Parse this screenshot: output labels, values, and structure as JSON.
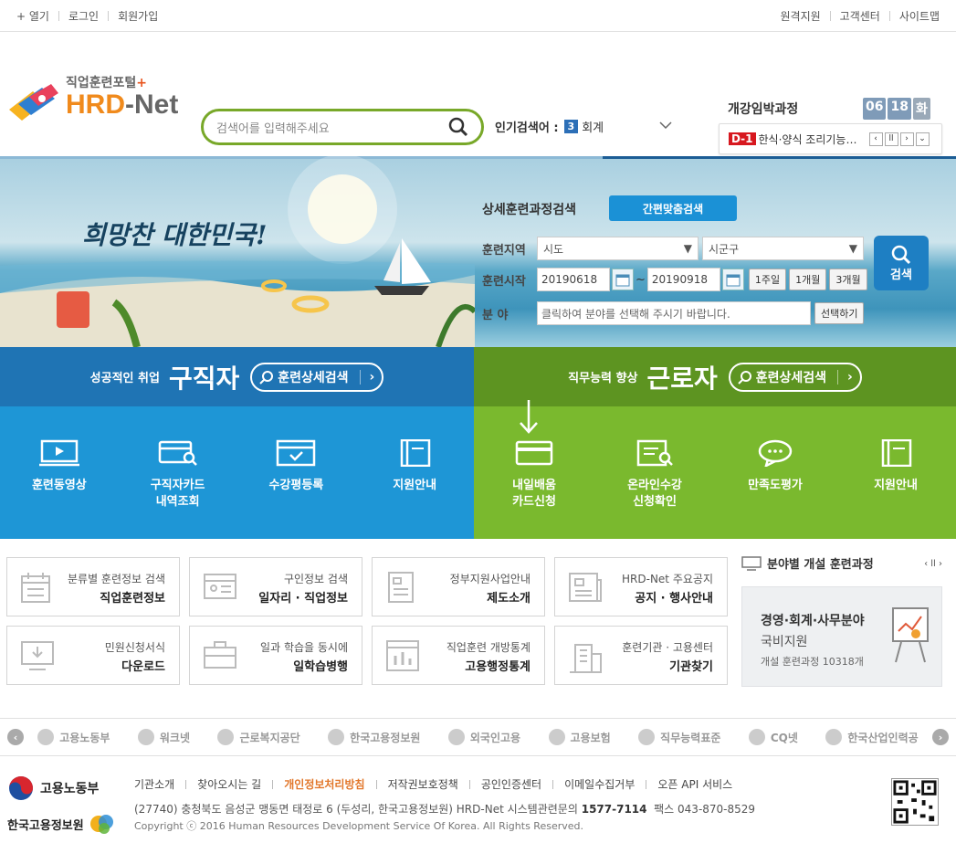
{
  "topbar": {
    "left": [
      "+ 열기",
      "로그인",
      "회원가입"
    ],
    "right": [
      "원격지원",
      "고객센터",
      "사이트맵"
    ]
  },
  "logo": {
    "sub": "직업훈련포털",
    "plus": "+",
    "main_a": "HRD",
    "main_b": "-Net"
  },
  "search": {
    "placeholder": "검색어를 입력해주세요"
  },
  "popular": {
    "label": "인기검색어 :",
    "rank": "3",
    "keyword": "회계"
  },
  "imminent": {
    "title": "개강임박과정",
    "month": "06",
    "day": "18",
    "weekday": "화",
    "badge": "D-1",
    "course": "한식·양식 조리기능사 과정"
  },
  "hero": {
    "slogan": "희망찬 대한민국!",
    "panel_title": "상세훈련과정검색",
    "quick_button": "간편맞춤검색",
    "region_label": "훈련지역",
    "region_select1": "시도",
    "region_select2": "시군구",
    "start_label": "훈련시작",
    "date_from": "20190618",
    "tilde": "~",
    "date_to": "20190918",
    "period_buttons": [
      "1주일",
      "1개월",
      "3개월"
    ],
    "field_label": "분  야",
    "field_placeholder": "클릭하여 분야를 선택해 주시기 바랍니다.",
    "field_button": "선택하기",
    "search_button": "검색"
  },
  "jobseeker": {
    "small": "성공적인 취업",
    "big": "구직자",
    "button": "훈련상세검색",
    "tiles": [
      {
        "l1": "훈련동영상",
        "l2": ""
      },
      {
        "l1": "구직자카드",
        "l2": "내역조회"
      },
      {
        "l1": "수강평등록",
        "l2": ""
      },
      {
        "l1": "지원안내",
        "l2": ""
      }
    ]
  },
  "worker": {
    "small": "직무능력 향상",
    "big": "근로자",
    "button": "훈련상세검색",
    "tiles": [
      {
        "l1": "내일배움",
        "l2": "카드신청"
      },
      {
        "l1": "온라인수강",
        "l2": "신청확인"
      },
      {
        "l1": "만족도평가",
        "l2": ""
      },
      {
        "l1": "지원안내",
        "l2": ""
      }
    ]
  },
  "quick": [
    {
      "t1": "분류별 훈련정보 검색",
      "t2": "직업훈련정보"
    },
    {
      "t1": "구인정보 검색",
      "t2": "일자리 · 직업정보"
    },
    {
      "t1": "정부지원사업안내",
      "t2": "제도소개"
    },
    {
      "t1": "HRD-Net 주요공지",
      "t2": "공지 · 행사안내"
    },
    {
      "t1": "민원신청서식",
      "t2": "다운로드"
    },
    {
      "t1": "일과 학습을 동시에",
      "t2": "일학습병행"
    },
    {
      "t1": "직업훈련 개방통계",
      "t2": "고용행정통계"
    },
    {
      "t1": "훈련기관 · 고용센터",
      "t2": "기관찾기"
    }
  ],
  "field": {
    "title": "분야별 개설 훈련과정",
    "controls": "‹ ll ›",
    "f1": "경영·회계·사무분야",
    "f2": "국비지원",
    "f3": "개설 훈련과정 10318개"
  },
  "partners": [
    "고용노동부",
    "워크넷",
    "근로복지공단",
    "한국고용정보원",
    "외국인고용",
    "고용보험",
    "직무능력표준",
    "CQ넷",
    "한국산업인력공"
  ],
  "footer": {
    "org1": "고용노동부",
    "org2": "한국고용정보원",
    "links": [
      "기관소개",
      "찾아오시는 길",
      "개인정보처리방침",
      "저작권보호정책",
      "공인인증센터",
      "이메일수집거부",
      "오픈 API 서비스"
    ],
    "address": "(27740) 충청북도 음성군 맹동면 태정로 6 (두성리, 한국고용정보원) HRD-Net 시스템관련문의",
    "phone": "1577-7114",
    "fax": "팩스 043-870-8529",
    "copyright": "Copyright ⓒ 2016 Human Resources Development Service Of Korea. All Rights Reserved."
  },
  "colors": {
    "blue": "#1e96d6",
    "blue_dark": "#1f74b4",
    "green": "#7ab92e",
    "green_dark": "#5d9421",
    "orange": "#f08a1c"
  }
}
